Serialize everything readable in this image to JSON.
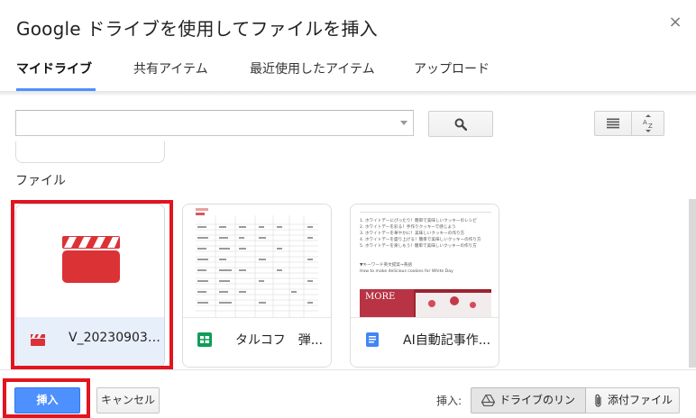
{
  "dialog": {
    "title": "Google ドライブを使用してファイルを挿入",
    "close_glyph": "×"
  },
  "tabs": [
    {
      "label": "マイドライブ",
      "active": true
    },
    {
      "label": "共有アイテム",
      "active": false
    },
    {
      "label": "最近使用したアイテム",
      "active": false
    },
    {
      "label": "アップロード",
      "active": false
    }
  ],
  "search": {
    "value": "",
    "placeholder": ""
  },
  "section": {
    "label": "ファイル"
  },
  "files": [
    {
      "name": "V_20230903_...",
      "type": "video",
      "selected": true
    },
    {
      "name": "タルコフ　弾...",
      "type": "spreadsheet",
      "selected": false
    },
    {
      "name": "AI自動記事作...",
      "type": "document",
      "selected": false
    }
  ],
  "doc_preview": {
    "lines": [
      "1. ホワイトデーにぴったり！簡単で美味しいクッキーのレシピ",
      "2. ホワイトデーを彩る！手作りクッキーで感じよう",
      "3. ホワイトデーを華やかに！美味しいクッキーの作り方",
      "4. ホワイトデーを盛り上げる！簡単で美味しいクッキーの作り方",
      "5. ホワイトデーを楽しもう！簡単で美味しいクッキーの作り方"
    ],
    "keyword": "▼キーワード英文提案→英語",
    "english": "How to make delicious cookies for White Day",
    "image_text": "MORE"
  },
  "footer": {
    "insert_button": "挿入",
    "cancel_button": "キャンセル",
    "insert_as_label": "挿入:",
    "drive_link_button": "ドライブのリンク",
    "attach_button": "添付ファイル"
  },
  "colors": {
    "accent": "#4d90fe",
    "highlight": "#e2141e",
    "video_icon": "#db3236",
    "sheet_icon": "#0f9d58",
    "doc_icon": "#4285f4"
  }
}
